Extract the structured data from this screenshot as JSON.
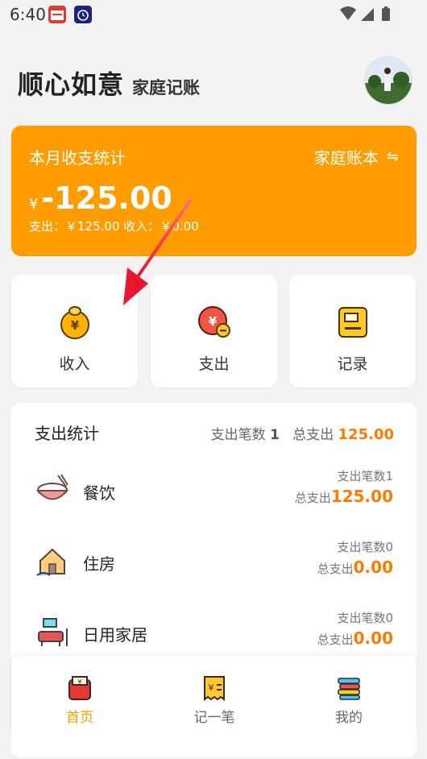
{
  "status_bar": {
    "time": "6:40"
  },
  "header": {
    "title": "顺心如意",
    "subtitle": "家庭记账"
  },
  "summary": {
    "title": "本月收支统计",
    "book_label": "家庭账本",
    "book_icon": "⇋",
    "currency": "¥",
    "amount": "-125.00",
    "detail": "支出：￥125.00   收入：￥0.00"
  },
  "quick_actions": [
    {
      "label": "收入",
      "icon": "income-coin-icon"
    },
    {
      "label": "支出",
      "icon": "expense-coin-icon"
    },
    {
      "label": "记录",
      "icon": "record-list-icon"
    }
  ],
  "stats": {
    "title": "支出统计",
    "count_label": "支出笔数",
    "count": "1",
    "total_label": "总支出",
    "total": "125.00",
    "categories": [
      {
        "name": "餐饮",
        "count_text": "支出笔数1",
        "total_label": "总支出",
        "total": "125.00",
        "icon": "rice-bowl-icon"
      },
      {
        "name": "住房",
        "count_text": "支出笔数0",
        "total_label": "总支出",
        "total": "0.00",
        "icon": "house-icon"
      },
      {
        "name": "日用家居",
        "count_text": "支出笔数0",
        "total_label": "总支出",
        "total": "0.00",
        "icon": "home-goods-icon"
      }
    ]
  },
  "bottom_nav": [
    {
      "label": "首页",
      "active": true
    },
    {
      "label": "记一笔",
      "active": false
    },
    {
      "label": "我的",
      "active": false
    }
  ],
  "colors": {
    "accent": "#ff9d00",
    "amount": "#ff7a00"
  }
}
